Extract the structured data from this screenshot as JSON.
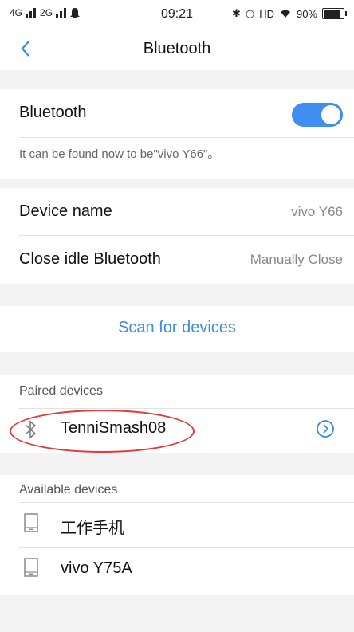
{
  "status_bar": {
    "signal_1": "4G",
    "signal_2": "2G",
    "time": "09:21",
    "network": "HD",
    "battery": "90%",
    "battery_level": 0.9
  },
  "nav": {
    "title": "Bluetooth"
  },
  "bluetooth": {
    "label": "Bluetooth",
    "enabled": true,
    "discoverable_note": "It can be found now to be\"vivo Y66\"。"
  },
  "settings": {
    "device_name_label": "Device name",
    "device_name_value": "vivo Y66",
    "close_idle_label": "Close idle Bluetooth",
    "close_idle_value": "Manually Close"
  },
  "scan": {
    "label": "Scan for devices"
  },
  "paired": {
    "header": "Paired devices",
    "devices": [
      {
        "name": "TenniSmash08",
        "icon": "bluetooth-icon"
      }
    ]
  },
  "available": {
    "header": "Available devices",
    "devices": [
      {
        "name": "工作手机",
        "icon": "phone-icon"
      },
      {
        "name": "vivo Y75A",
        "icon": "phone-icon"
      }
    ]
  },
  "colors": {
    "accent": "#3f8ef0",
    "annotation": "#e23a3a"
  }
}
